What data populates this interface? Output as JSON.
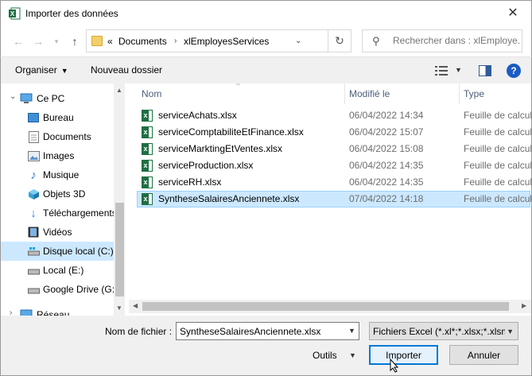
{
  "window": {
    "title": "Importer des données"
  },
  "address": {
    "overflow": "«",
    "crumbs": [
      "Documents",
      "xlEmployesServices"
    ]
  },
  "search": {
    "placeholder": "Rechercher dans : xlEmploye..."
  },
  "toolbar": {
    "organize": "Organiser",
    "new_folder": "Nouveau dossier"
  },
  "sidebar": {
    "items": [
      {
        "label": "Ce PC",
        "icon": "computer-icon"
      },
      {
        "label": "Bureau",
        "icon": "desktop-icon"
      },
      {
        "label": "Documents",
        "icon": "documents-icon"
      },
      {
        "label": "Images",
        "icon": "images-icon"
      },
      {
        "label": "Musique",
        "icon": "music-icon"
      },
      {
        "label": "Objets 3D",
        "icon": "objects-3d-icon"
      },
      {
        "label": "Téléchargements",
        "icon": "downloads-icon"
      },
      {
        "label": "Vidéos",
        "icon": "videos-icon"
      },
      {
        "label": "Disque local (C:)",
        "icon": "drive-icon"
      },
      {
        "label": "Local (E:)",
        "icon": "drive-icon"
      },
      {
        "label": "Google Drive (G:",
        "icon": "drive-icon"
      },
      {
        "label": "Réseau",
        "icon": "network-icon"
      }
    ]
  },
  "columns": {
    "name": "Nom",
    "modified": "Modifié le",
    "type": "Type"
  },
  "files": [
    {
      "name": "serviceAchats.xlsx",
      "modified": "06/04/2022 14:34",
      "type": "Feuille de calcul"
    },
    {
      "name": "serviceComptabiliteEtFinance.xlsx",
      "modified": "06/04/2022 15:07",
      "type": "Feuille de calcul"
    },
    {
      "name": "serviceMarktingEtVentes.xlsx",
      "modified": "06/04/2022 15:08",
      "type": "Feuille de calcul"
    },
    {
      "name": "serviceProduction.xlsx",
      "modified": "06/04/2022 14:35",
      "type": "Feuille de calcul"
    },
    {
      "name": "serviceRH.xlsx",
      "modified": "06/04/2022 14:35",
      "type": "Feuille de calcul"
    },
    {
      "name": "SyntheseSalairesAnciennete.xlsx",
      "modified": "07/04/2022 14:18",
      "type": "Feuille de calcul"
    }
  ],
  "footer": {
    "filename_label": "Nom de fichier :",
    "filename_value": "SyntheseSalairesAnciennete.xlsx",
    "filetype": "Fichiers Excel (*.xl*;*.xlsx;*.xlsm",
    "tools": "Outils",
    "import": "Importer",
    "cancel": "Annuler"
  },
  "colors": {
    "selection": "#cce8ff",
    "accent": "#0078d7",
    "excel_green": "#1d6f42"
  }
}
